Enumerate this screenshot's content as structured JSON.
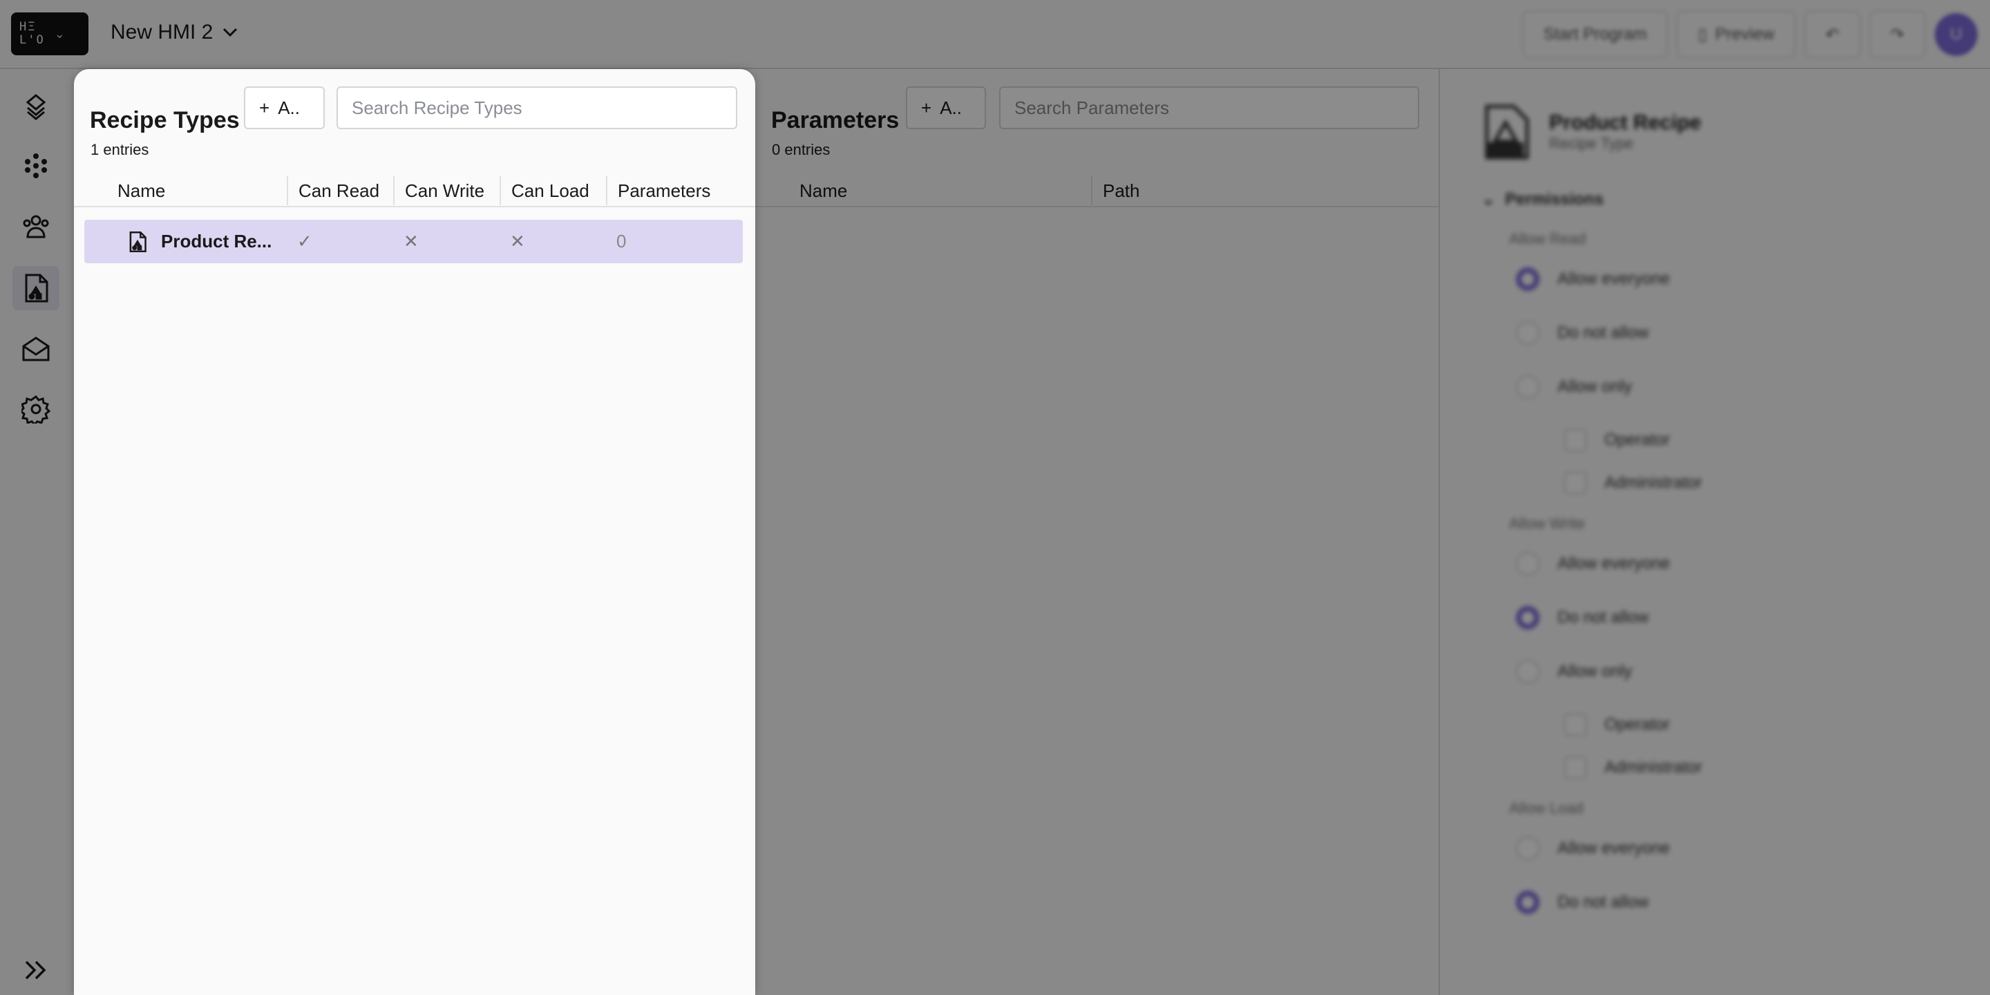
{
  "app": {
    "logo_text": "HELO",
    "project_name": "New HMI 2"
  },
  "topbar": {
    "start_label": "Start Program",
    "preview_label": "Preview",
    "avatar_initial": "U"
  },
  "rail": {
    "items": [
      "layers",
      "components",
      "users",
      "recipes",
      "messages",
      "settings"
    ],
    "active": "recipes",
    "expand_icon": "chevrons-right"
  },
  "recipe_types": {
    "title": "Recipe Types",
    "add_label": "A..",
    "search_placeholder": "Search Recipe Types",
    "count": "1 entries",
    "columns": [
      "Name",
      "Can Read",
      "Can Write",
      "Can Load",
      "Parameters"
    ],
    "rows": [
      {
        "name": "Product Re...",
        "can_read": "✓",
        "can_write": "✕",
        "can_load": "✕",
        "parameters": "0"
      }
    ]
  },
  "parameters": {
    "title": "Parameters",
    "add_label": "A..",
    "search_placeholder": "Search Parameters",
    "count": "0 entries",
    "columns": [
      "Name",
      "Path"
    ]
  },
  "details": {
    "title": "Product Recipe",
    "subtitle": "Recipe Type",
    "section": "Permissions",
    "groups": [
      {
        "label": "Allow Read",
        "options": [
          "Allow everyone",
          "Do not allow",
          "Allow only"
        ],
        "selected": 0,
        "roles": [
          "Operator",
          "Administrator"
        ]
      },
      {
        "label": "Allow Write",
        "options": [
          "Allow everyone",
          "Do not allow",
          "Allow only"
        ],
        "selected": 1,
        "roles": [
          "Operator",
          "Administrator"
        ]
      },
      {
        "label": "Allow Load",
        "options": [
          "Allow everyone",
          "Do not allow"
        ],
        "selected": 1
      }
    ]
  },
  "colors": {
    "accent": "#7b6bd8",
    "row_selected": "#ddd6f2",
    "overlay": "rgba(0,0,0,0.45)"
  }
}
